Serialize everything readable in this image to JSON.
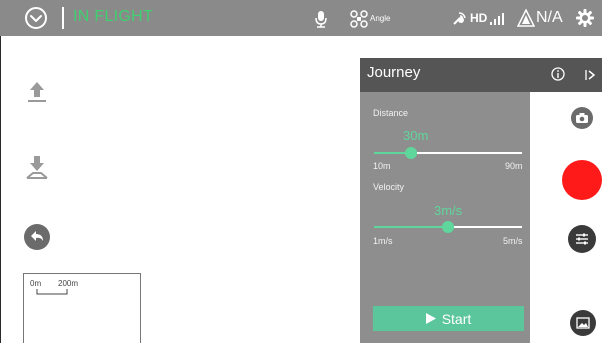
{
  "topbar": {
    "status": "IN FLIGHT",
    "angle_label": "Angle",
    "signal_label": "HD",
    "gps_value": "N/A"
  },
  "scale_bar": {
    "start_label": "0m",
    "end_label": "200m"
  },
  "journey": {
    "title": "Journey",
    "distance": {
      "label": "Distance",
      "value": "30m",
      "min": "10m",
      "max": "90m",
      "fraction": 0.25
    },
    "velocity": {
      "label": "Velocity",
      "value": "3m/s",
      "min": "1m/s",
      "max": "5m/s",
      "fraction": 0.5
    },
    "start_label": "Start"
  },
  "colors": {
    "accent": "#5fd69c",
    "record": "#ff1a1a",
    "topbar": "#8a8a8a",
    "panel_header": "#555555",
    "panel": "#8e8e8e"
  },
  "icons": {
    "home": "chevron-circle-icon",
    "mic": "microphone-icon",
    "drone": "drone-icon",
    "remote": "remote-controller-icon",
    "signal": "signal-bars-icon",
    "gps": "satellite-icon",
    "settings": "gear-icon",
    "takeoff": "takeoff-icon",
    "land": "landing-icon",
    "return": "return-home-icon",
    "info": "info-icon",
    "collapse": "collapse-arrow-icon",
    "camera_switch": "camera-switch-icon",
    "record": "record-button",
    "camera_settings": "camera-settings-icon",
    "gallery": "gallery-icon"
  }
}
